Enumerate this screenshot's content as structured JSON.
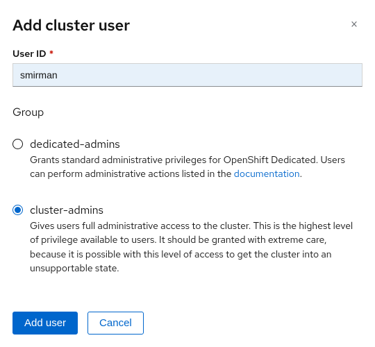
{
  "dialog": {
    "title": "Add cluster user",
    "close_symbol": "×"
  },
  "user_id": {
    "label": "User ID",
    "required_marker": "*",
    "value": "smirman"
  },
  "group": {
    "label": "Group",
    "options": [
      {
        "value": "dedicated-admins",
        "title": "dedicated-admins",
        "desc_pre": "Grants standard administrative privileges for OpenShift Dedicated. Users can perform administrative actions listed in the ",
        "link_text": "documentation",
        "desc_post": ".",
        "selected": false
      },
      {
        "value": "cluster-admins",
        "title": "cluster-admins",
        "desc": "Gives users full administrative access to the cluster. This is the highest level of privilege available to users. It should be granted with extreme care, because it is possible with this level of access to get the cluster into an unsupportable state.",
        "selected": true
      }
    ]
  },
  "footer": {
    "submit_label": "Add user",
    "cancel_label": "Cancel"
  }
}
